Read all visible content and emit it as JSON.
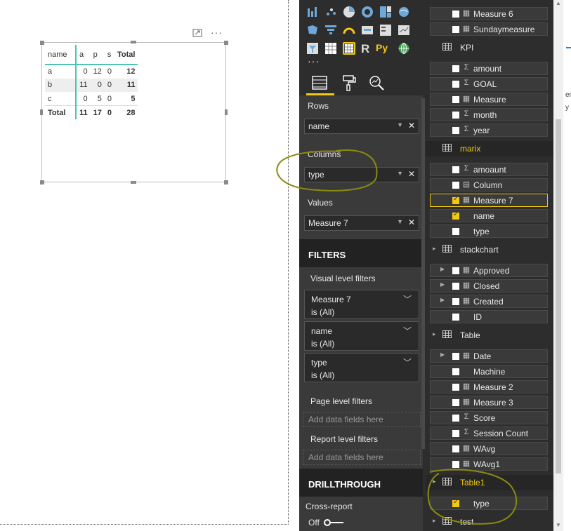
{
  "matrix": {
    "headers": [
      "name",
      "a",
      "p",
      "s",
      "Total"
    ],
    "rows": [
      {
        "name": "a",
        "a": "0",
        "p": "12",
        "s": "0",
        "total": "12"
      },
      {
        "name": "b",
        "a": "11",
        "p": "0",
        "s": "0",
        "total": "11"
      },
      {
        "name": "c",
        "a": "0",
        "p": "5",
        "s": "0",
        "total": "5"
      }
    ],
    "grand": {
      "name": "Total",
      "a": "11",
      "p": "17",
      "s": "0",
      "total": "28"
    }
  },
  "canvas": {
    "more_label": "···"
  },
  "visualizations": {
    "more_label": "···",
    "wells": {
      "rows_label": "Rows",
      "rows_value": "name",
      "columns_label": "Columns",
      "columns_value": "type",
      "values_label": "Values",
      "values_value": "Measure 7"
    },
    "filters": {
      "title": "FILTERS",
      "visual_level": "Visual level filters",
      "cards": [
        {
          "field": "Measure 7",
          "state": "is (All)"
        },
        {
          "field": "name",
          "state": "is (All)"
        },
        {
          "field": "type",
          "state": "is (All)"
        }
      ],
      "page_level": "Page level filters",
      "report_level": "Report level filters",
      "add_fields": "Add data fields here"
    },
    "drillthrough": {
      "title": "DRILLTHROUGH",
      "cross_report": "Cross-report",
      "off": "Off"
    }
  },
  "fields": {
    "top_rows": [
      "Measure 6",
      "Sundaymeasure"
    ],
    "kpi": {
      "name": "KPI",
      "items": [
        "amount",
        "GOAL",
        "Measure",
        "month",
        "year"
      ]
    },
    "marix": {
      "name": "marix",
      "items": [
        "amoaunt",
        "Column",
        "Measure 7",
        "name",
        "type"
      ]
    },
    "stackchart": {
      "name": "stackchart",
      "items": [
        "Approved",
        "Closed",
        "Created",
        "ID"
      ]
    },
    "table": {
      "name": "Table",
      "items": [
        "Date",
        "Machine",
        "Measure 2",
        "Measure 3",
        "Score",
        "Session Count",
        "WAvg",
        "WAvg1"
      ]
    },
    "table1": {
      "name": "Table1",
      "items": [
        "type"
      ]
    },
    "test": {
      "name": "test"
    }
  },
  "right_edge": {
    "t1": "er",
    "t2": "y"
  },
  "colors": {
    "accent": "#f2c811",
    "matrix_line": "#4fc3b0",
    "pane_bg": "#2d2d2d",
    "annotation": "#8a8a10"
  }
}
